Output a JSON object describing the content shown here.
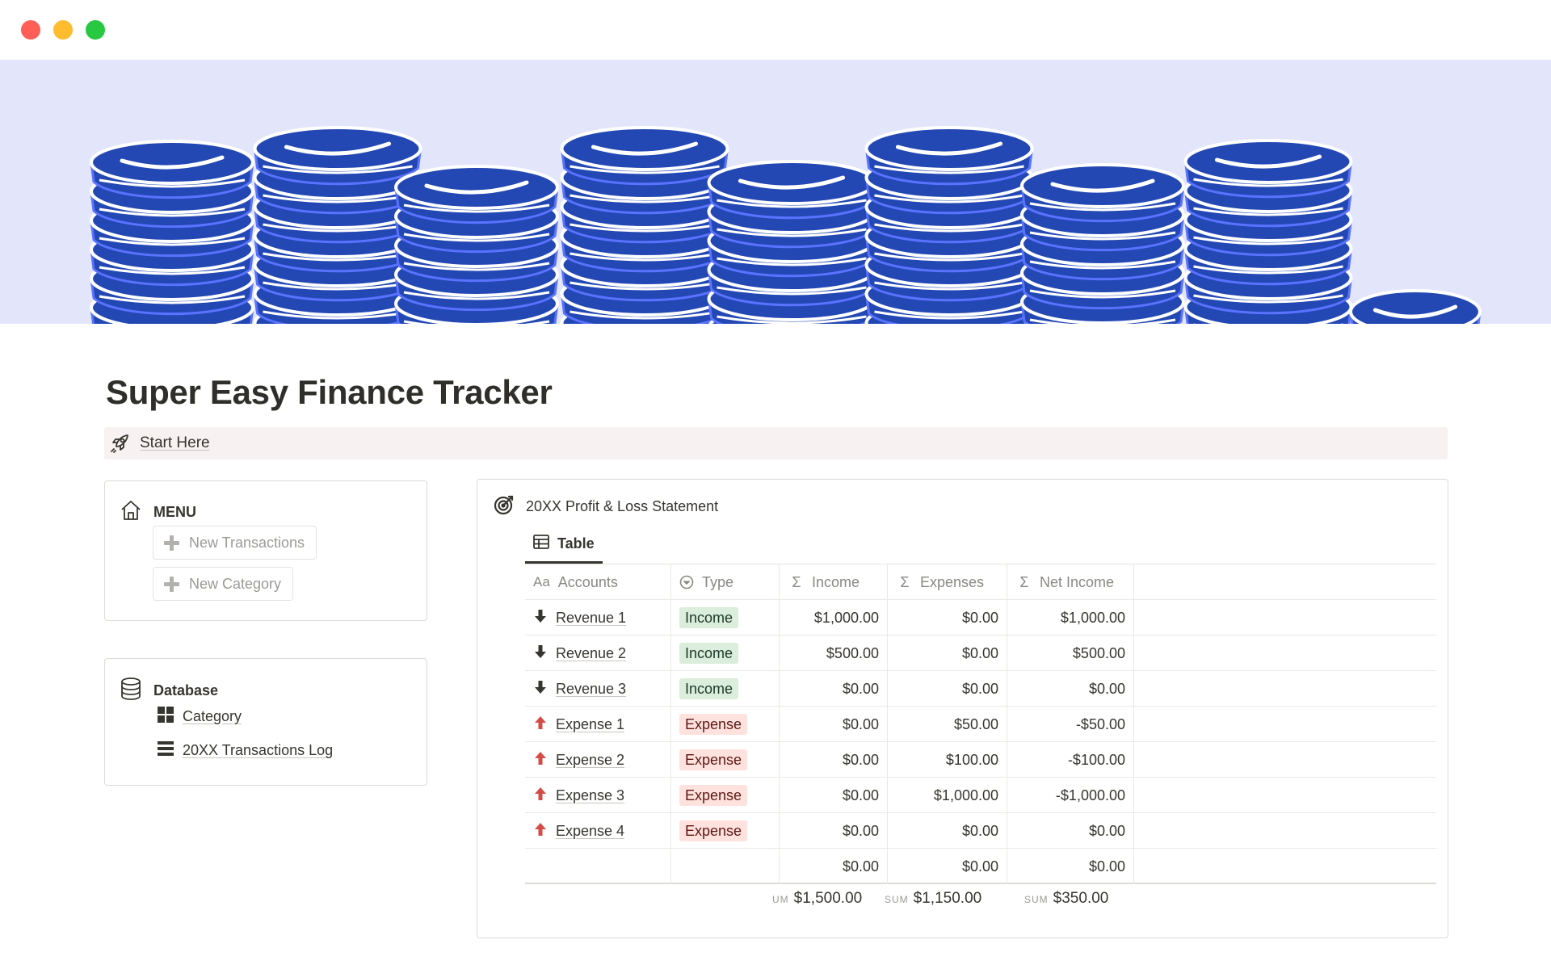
{
  "page": {
    "title": "Super Easy Finance Tracker",
    "start_here": "Start Here"
  },
  "menu": {
    "label": "MENU",
    "buttons": [
      "New Transactions",
      "New Category"
    ]
  },
  "database": {
    "label": "Database",
    "links": [
      "Category",
      "20XX Transactions Log"
    ]
  },
  "pl": {
    "title": "20XX Profit & Loss Statement",
    "view_tab": "Table",
    "columns": [
      "Accounts",
      "Type",
      "Income",
      "Expenses",
      "Net Income"
    ],
    "rows": [
      {
        "account": "Revenue 1",
        "type": "Income",
        "income": "$1,000.00",
        "expenses": "$0.00",
        "net": "$1,000.00"
      },
      {
        "account": "Revenue 2",
        "type": "Income",
        "income": "$500.00",
        "expenses": "$0.00",
        "net": "$500.00"
      },
      {
        "account": "Revenue 3",
        "type": "Income",
        "income": "$0.00",
        "expenses": "$0.00",
        "net": "$0.00"
      },
      {
        "account": "Expense 1",
        "type": "Expense",
        "income": "$0.00",
        "expenses": "$50.00",
        "net": "-$50.00"
      },
      {
        "account": "Expense 2",
        "type": "Expense",
        "income": "$0.00",
        "expenses": "$100.00",
        "net": "-$100.00"
      },
      {
        "account": "Expense 3",
        "type": "Expense",
        "income": "$0.00",
        "expenses": "$1,000.00",
        "net": "-$1,000.00"
      },
      {
        "account": "Expense 4",
        "type": "Expense",
        "income": "$0.00",
        "expenses": "$0.00",
        "net": "$0.00"
      }
    ],
    "blank_row": {
      "income": "$0.00",
      "expenses": "$0.00",
      "net": "$0.00"
    },
    "sums": {
      "income_label": "UM",
      "income": "$1,500.00",
      "expenses_label": "SUM",
      "expenses": "$1,150.00",
      "net_label": "SUM",
      "net": "$350.00"
    }
  },
  "colors": {
    "cover_bg": "#e3e6fb",
    "coin_blue": "#2348b4",
    "income_pill": "#dbeddb",
    "expense_pill": "#ffe2dd",
    "expense_arrow": "#d44c47",
    "income_arrow": "#37352f"
  },
  "icons": {
    "start_here": "rocket-icon",
    "menu": "home-icon",
    "database": "database-icon",
    "category": "grid-icon",
    "transactions": "list-icon",
    "pl": "target-icon",
    "table_view": "table-icon",
    "income_row": "arrow-down-icon",
    "expense_row": "arrow-up-icon"
  }
}
